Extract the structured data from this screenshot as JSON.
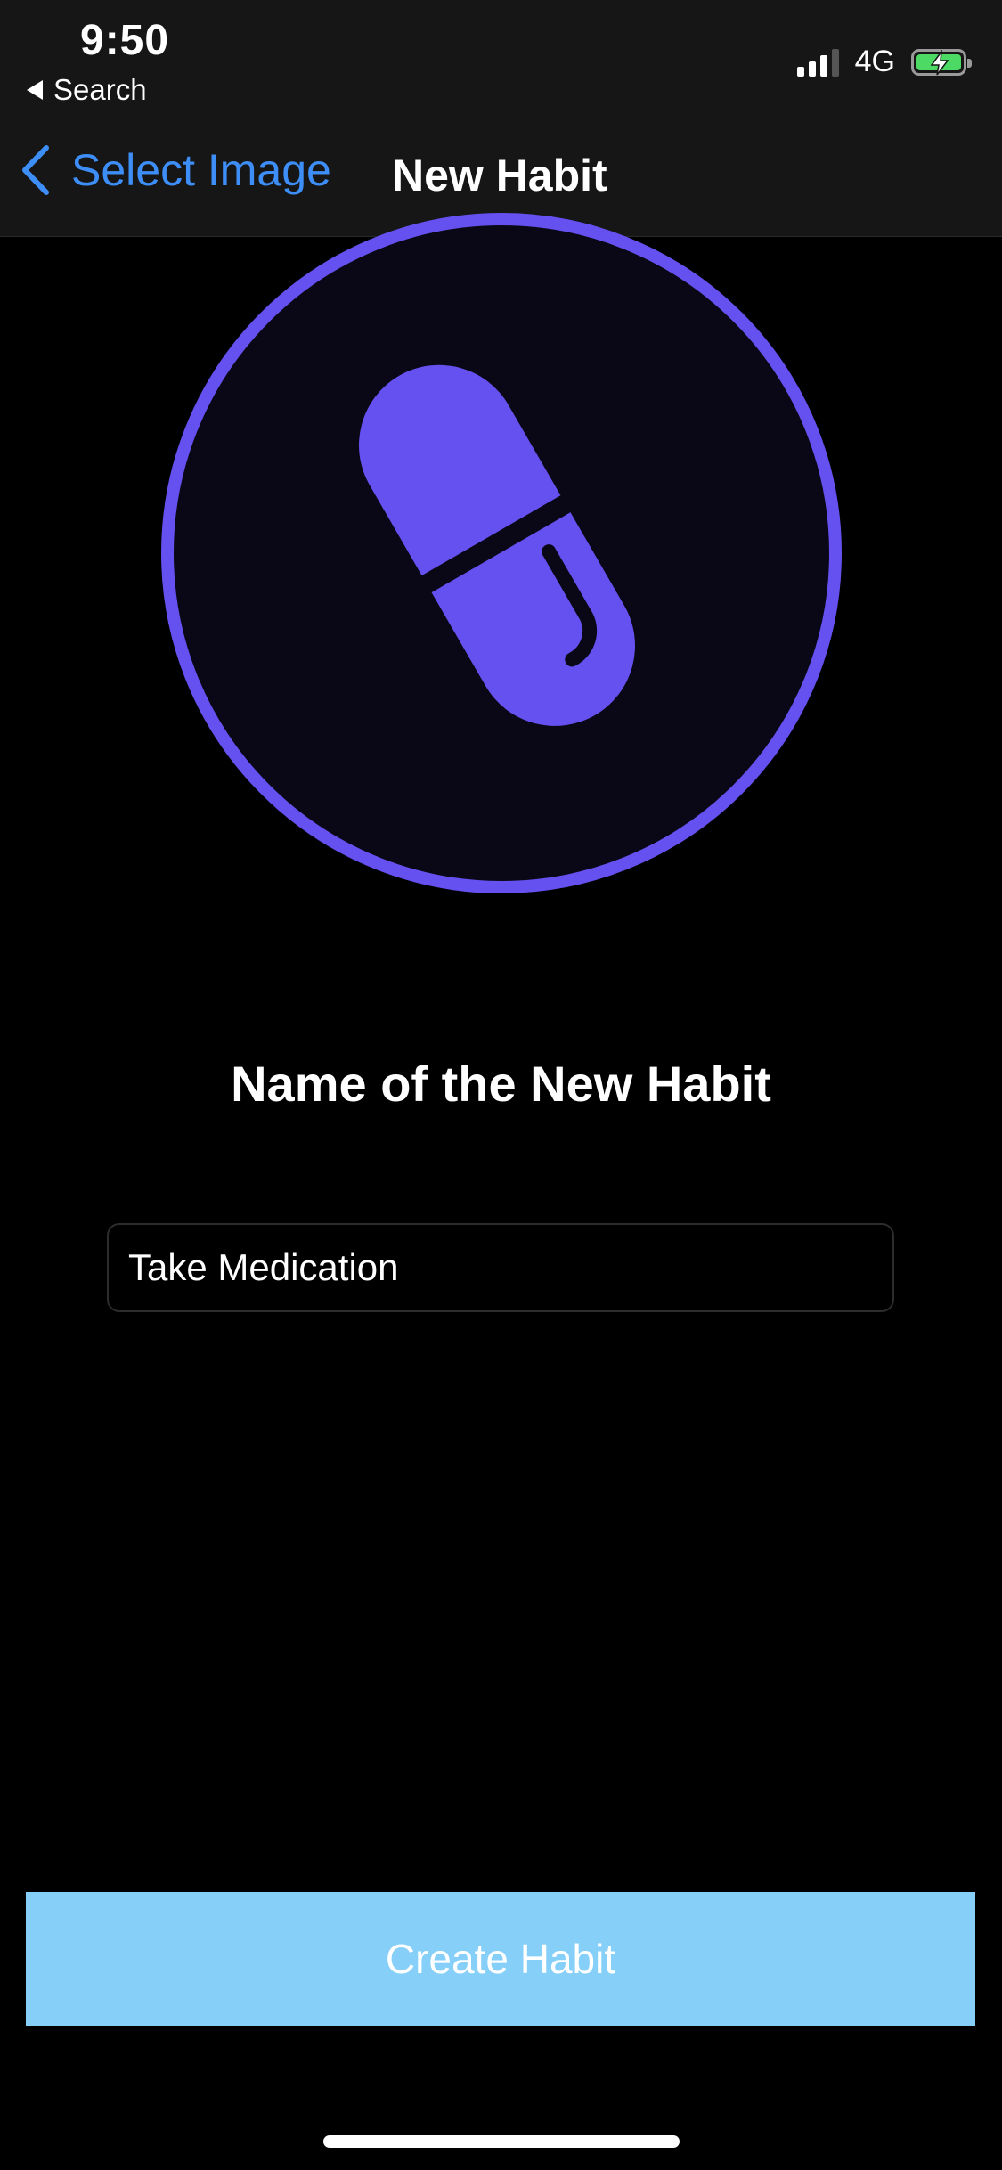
{
  "status_bar": {
    "time": "9:50",
    "back_app": "Search",
    "network": "4G"
  },
  "nav": {
    "back_label": "Select Image",
    "title": "New Habit"
  },
  "habit_icon": {
    "icon": "pill-icon",
    "accent_color": "#6550f0",
    "circle_fill": "#0a0816"
  },
  "form": {
    "label": "Name of the New Habit",
    "name_value": "Take Medication"
  },
  "actions": {
    "create_label": "Create Habit",
    "create_color": "#86cff9"
  },
  "colors": {
    "link_blue": "#3e8ef7",
    "battery_green": "#4cd964"
  }
}
